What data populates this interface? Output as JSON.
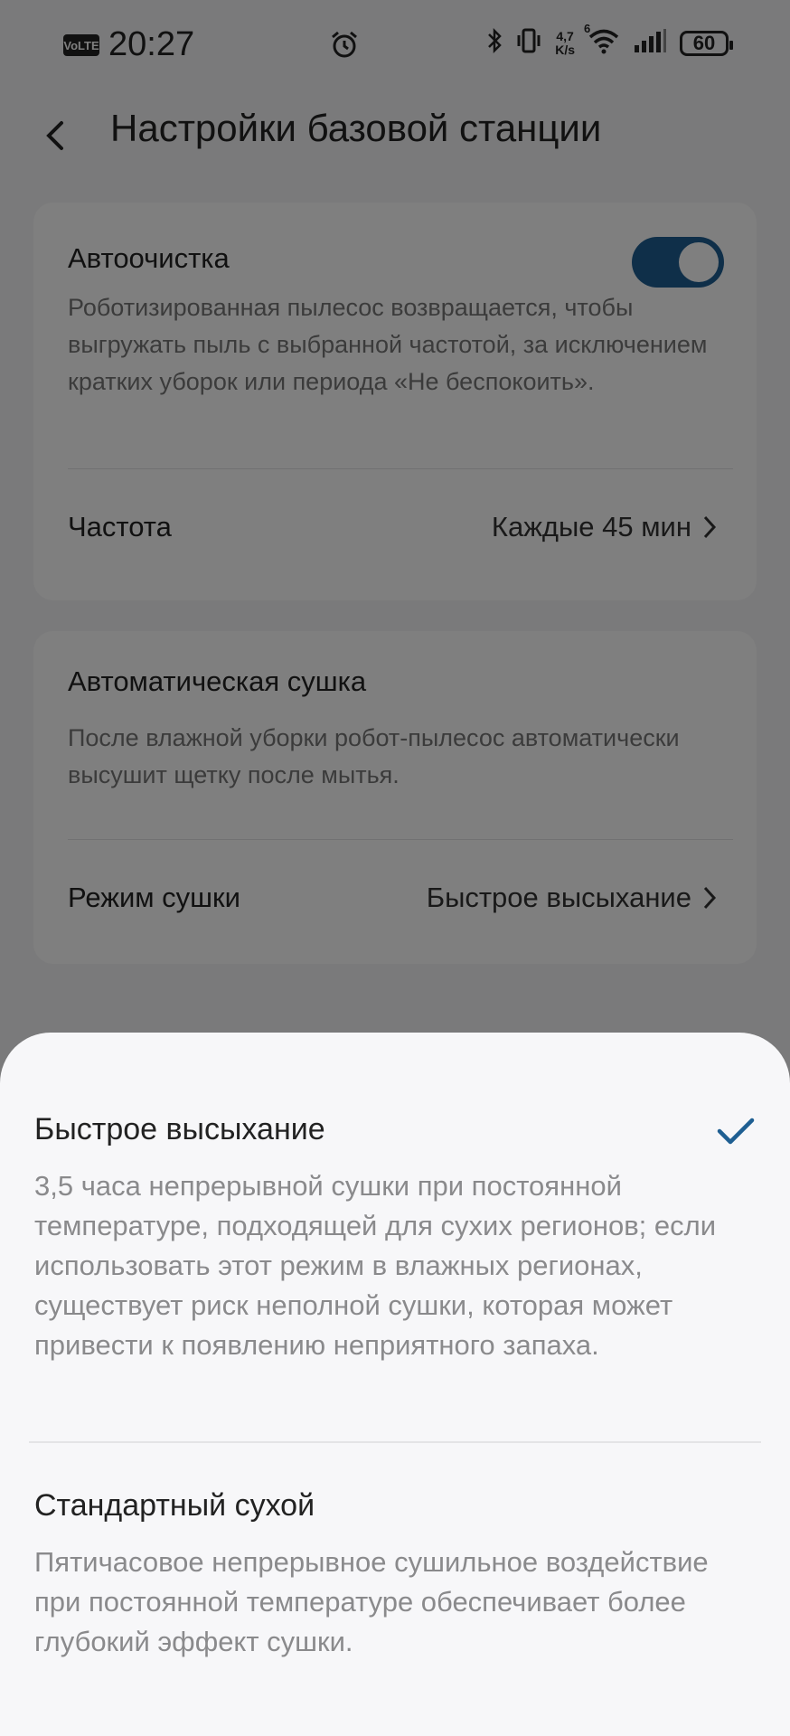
{
  "status_bar": {
    "volte": "VoLTE",
    "time": "20:27",
    "net_speed_value": "4,7",
    "net_speed_unit": "K/s",
    "network": "6",
    "battery": "60"
  },
  "header": {
    "title": "Настройки базовой станции",
    "back_icon": "chevron-left-icon"
  },
  "auto_clean": {
    "title": "Автоочистка",
    "description": "Роботизированная пылесос возвращается, чтобы выгружать пыль с выбранной частотой, за исключением кратких уборок или периода «Не беспокоить».",
    "enabled": true,
    "frequency_label": "Частота",
    "frequency_value": "Каждые 45 мин"
  },
  "auto_dry": {
    "title": "Автоматическая сушка",
    "description": "После влажной уборки робот-пылесос автоматически высушит щетку после мытья.",
    "mode_label": "Режим сушки",
    "mode_value": "Быстрое высыхание"
  },
  "sheet": {
    "options": [
      {
        "title": "Быстрое высыхание",
        "description": "3,5 часа непрерывной сушки при постоянной температуре, подходящей для сухих регионов; если использовать этот режим в влажных регионах, существует риск неполной сушки, которая может привести к появлению неприятного запаха.",
        "selected": true
      },
      {
        "title": "Стандартный сухой",
        "description": "Пятичасовое непрерывное сушильное воздействие при постоянной температуре обеспечивает более глубокий эффект сушки.",
        "selected": false
      }
    ],
    "accent_color": "#1f5f92"
  }
}
